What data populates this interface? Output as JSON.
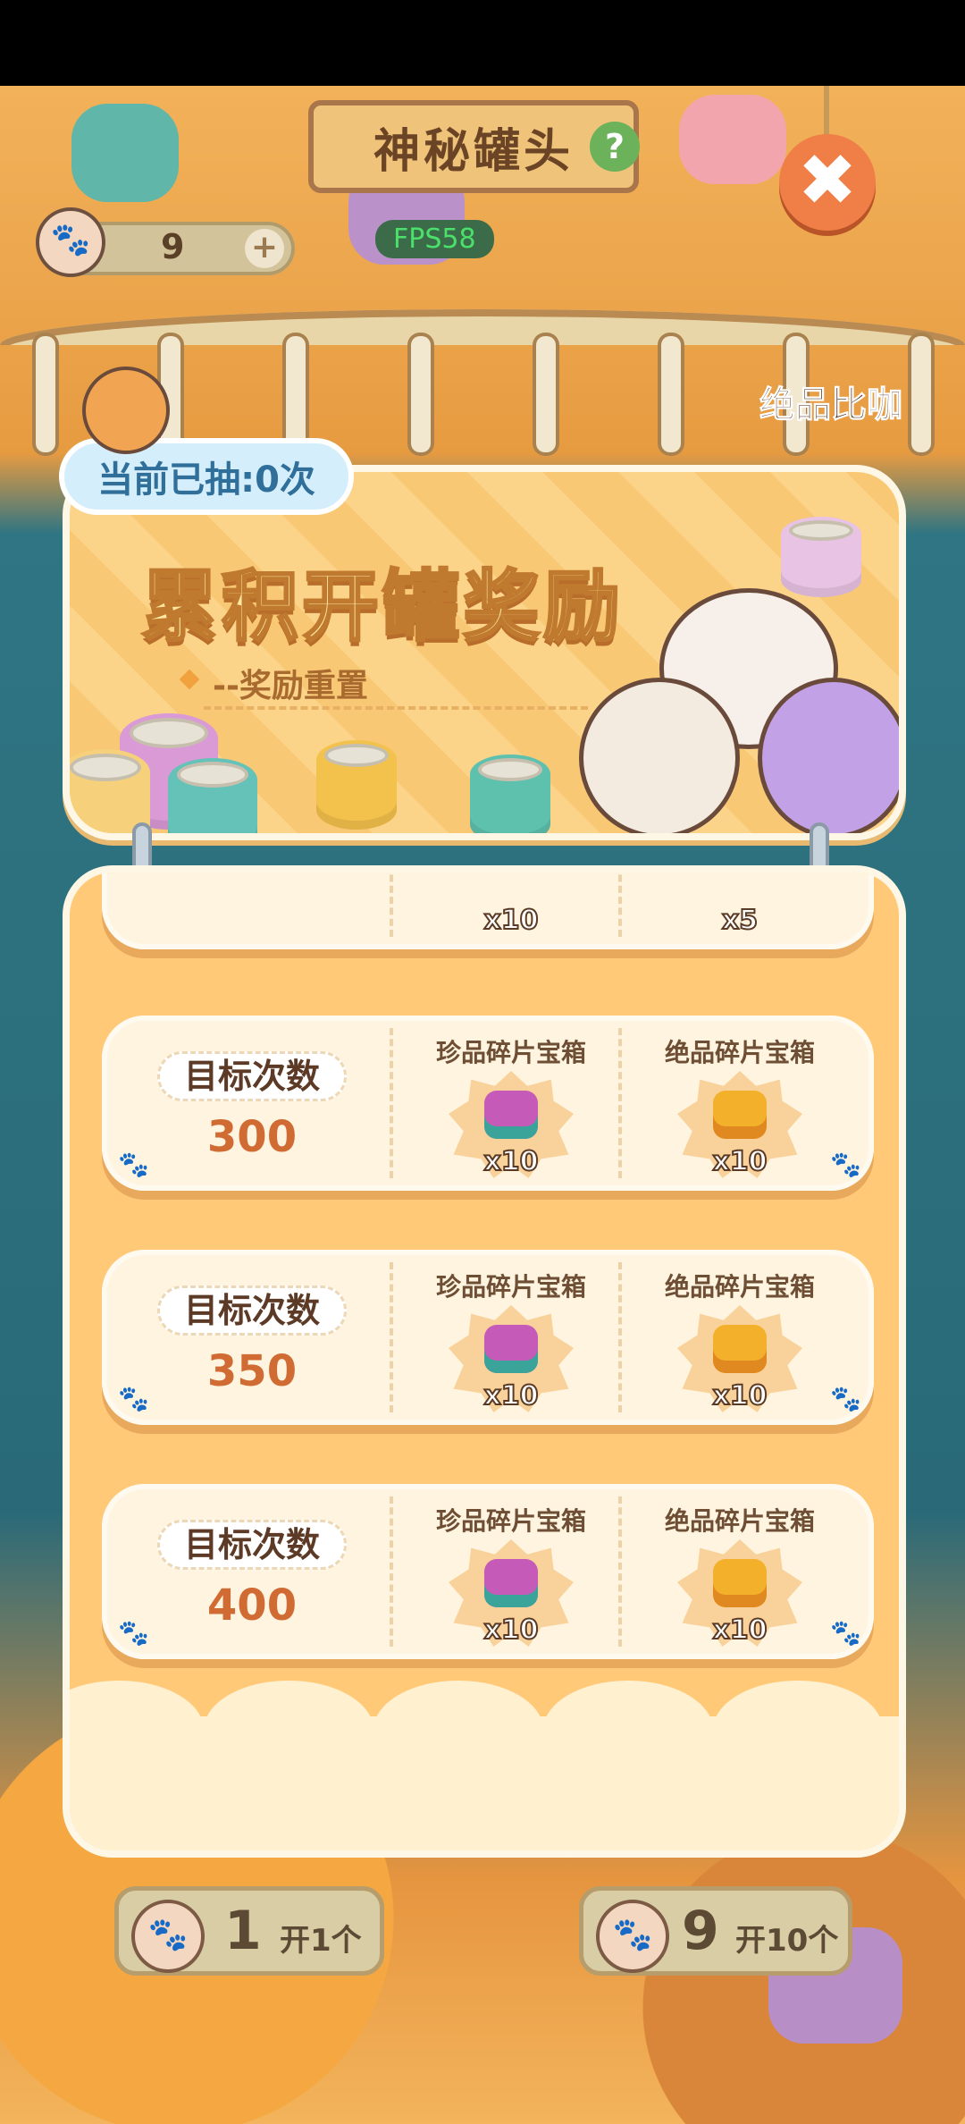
{
  "game": {
    "title": "神秘罐头",
    "fps": "FPS58",
    "currency_count": "9",
    "side_label": "绝品比咖"
  },
  "panel": {
    "draw_count": "当前已抽:0次",
    "title": "累积开罐奖励",
    "reset_note": "--奖励重置",
    "rows": [
      {
        "target_label": "目标次数",
        "target": "300",
        "rewards": [
          {
            "name": "珍品碎片宝箱",
            "qty": "x10"
          },
          {
            "name": "绝品碎片宝箱",
            "qty": "x10"
          }
        ]
      },
      {
        "target_label": "目标次数",
        "target": "350",
        "rewards": [
          {
            "name": "珍品碎片宝箱",
            "qty": "x10"
          },
          {
            "name": "绝品碎片宝箱",
            "qty": "x10"
          }
        ]
      },
      {
        "target_label": "目标次数",
        "target": "400",
        "rewards": [
          {
            "name": "珍品碎片宝箱",
            "qty": "x10"
          },
          {
            "name": "绝品碎片宝箱",
            "qty": "x10"
          }
        ]
      }
    ],
    "partial_row": {
      "qty_left": "x10",
      "qty_right": "x5"
    }
  },
  "buttons": {
    "open_one": {
      "count": "1",
      "label": "开1个"
    },
    "open_ten": {
      "count": "9",
      "label": "开10个"
    }
  },
  "icons": {
    "help": "?",
    "plus": "+",
    "close": "✖",
    "paw": "🐾"
  }
}
